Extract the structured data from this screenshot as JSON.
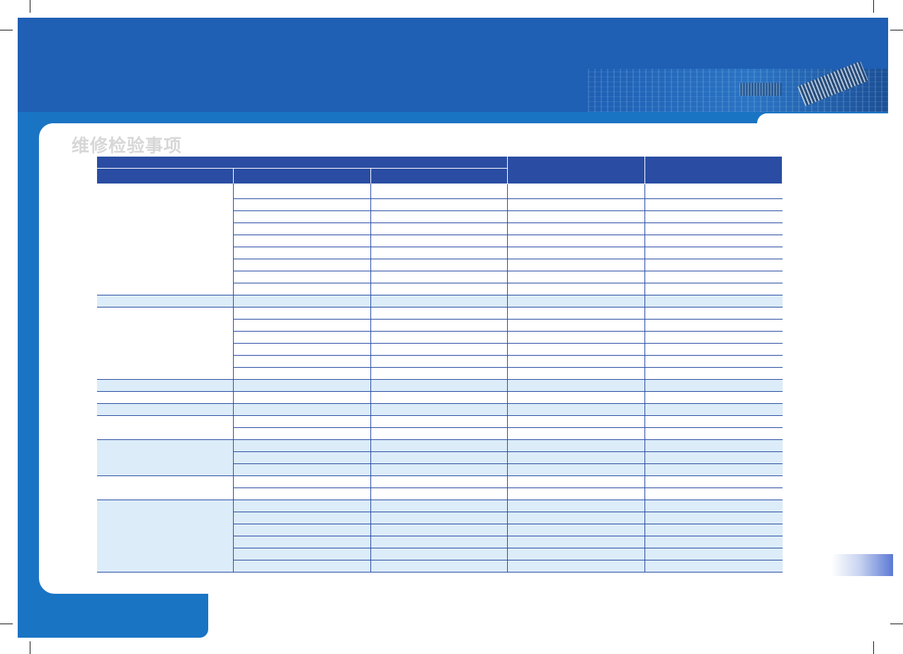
{
  "section": {
    "title": "维修检验事项"
  },
  "colors": {
    "banner": "#1f5fb4",
    "side_bar": "#1a74c4",
    "table_header": "#2a4da3",
    "row_shade": "#dcecf8",
    "title_text": "#d7d7d7"
  },
  "table": {
    "headers": [
      "",
      "",
      "",
      "",
      ""
    ],
    "groups": [
      {
        "rows": 9,
        "shaded": false
      },
      {
        "rows": 1,
        "shaded": true
      },
      {
        "rows": 6,
        "shaded": false
      },
      {
        "rows": 1,
        "shaded": true
      },
      {
        "rows": 1,
        "shaded": false
      },
      {
        "rows": 1,
        "shaded": true
      },
      {
        "rows": 2,
        "shaded": false
      },
      {
        "rows": 3,
        "shaded": true
      },
      {
        "rows": 2,
        "shaded": false
      },
      {
        "rows": 6,
        "shaded": true
      }
    ]
  }
}
